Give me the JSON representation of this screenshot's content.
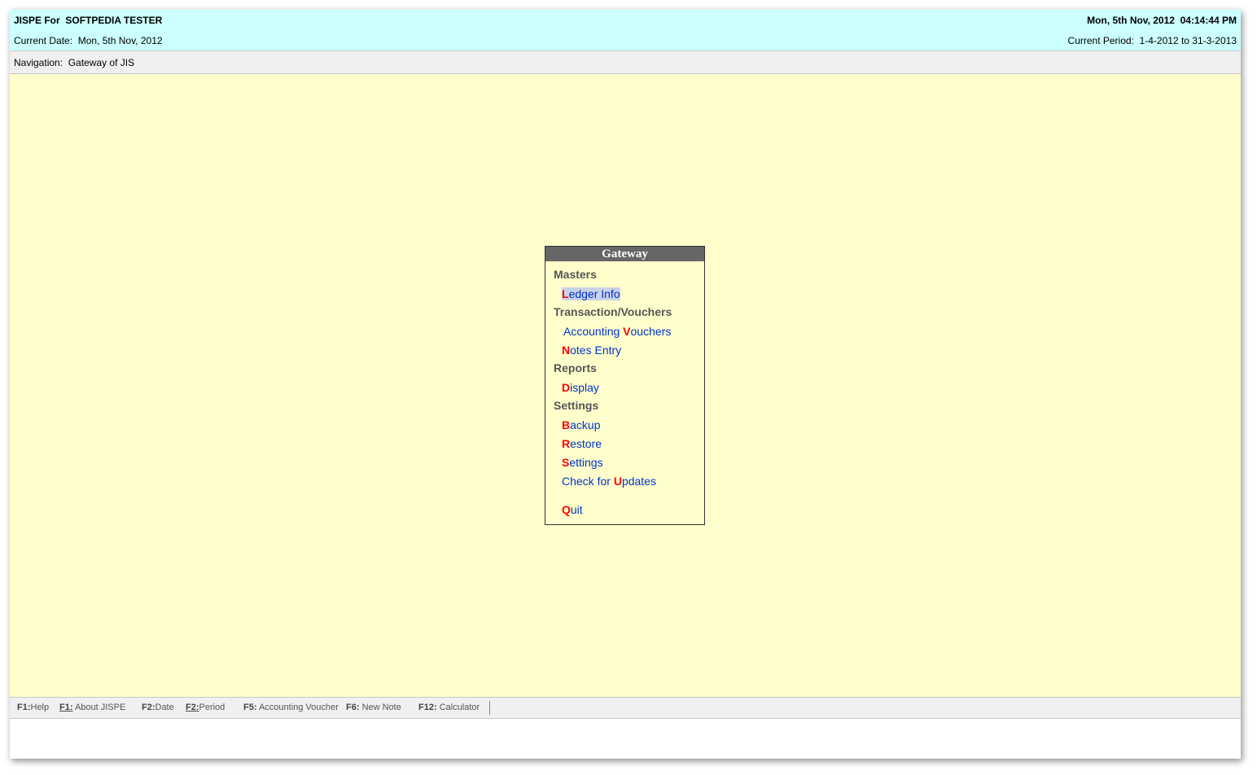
{
  "header": {
    "title": "JISPE For  SOFTPEDIA TESTER",
    "datetime": "Mon, 5th Nov, 2012  04:14:44 PM",
    "current_date_label": "Current Date:",
    "current_date_value": "Mon, 5th Nov, 2012",
    "current_period_label": "Current Period:",
    "current_period_value": "1-4-2012 to 31-3-2013"
  },
  "navigation": {
    "label": "Navigation:",
    "value": "Gateway of JIS"
  },
  "menu": {
    "title": "Gateway",
    "sections": {
      "masters": "Masters",
      "transactions": "Transaction/Vouchers",
      "reports": "Reports",
      "settings": "Settings"
    },
    "items": {
      "ledger_info": {
        "hotkey": "L",
        "rest": "edger Info"
      },
      "accounting_vouchers": {
        "pre": "Accounting ",
        "hotkey": "V",
        "rest": "ouchers"
      },
      "notes_entry": {
        "hotkey": "N",
        "rest": "otes Entry"
      },
      "display": {
        "hotkey": "D",
        "rest": "isplay"
      },
      "backup": {
        "hotkey": "B",
        "rest": "ackup"
      },
      "restore": {
        "hotkey": "R",
        "rest": "estore"
      },
      "settings": {
        "hotkey": "S",
        "rest": "ettings"
      },
      "check_updates": {
        "pre": "Check for ",
        "hotkey": "U",
        "rest": "pdates"
      },
      "quit": {
        "hotkey": "Q",
        "rest": "uit"
      }
    }
  },
  "footer": {
    "keys": [
      {
        "key": "F1:",
        "label": "Help"
      },
      {
        "key": "F1:",
        "label": "About JISPE"
      },
      {
        "key": "F2:",
        "label": "Date"
      },
      {
        "key": "F2:",
        "label": "Period"
      },
      {
        "key": "F5:",
        "label": "Accounting Voucher"
      },
      {
        "key": "F6:",
        "label": "New Note"
      },
      {
        "key": "F12:",
        "label": "Calculator"
      }
    ]
  },
  "colors": {
    "header_bg": "#ccffff",
    "main_bg": "#ffffcc",
    "menu_title_bg": "#666666",
    "link": "#0033cc",
    "hotkey": "#ff0000"
  }
}
